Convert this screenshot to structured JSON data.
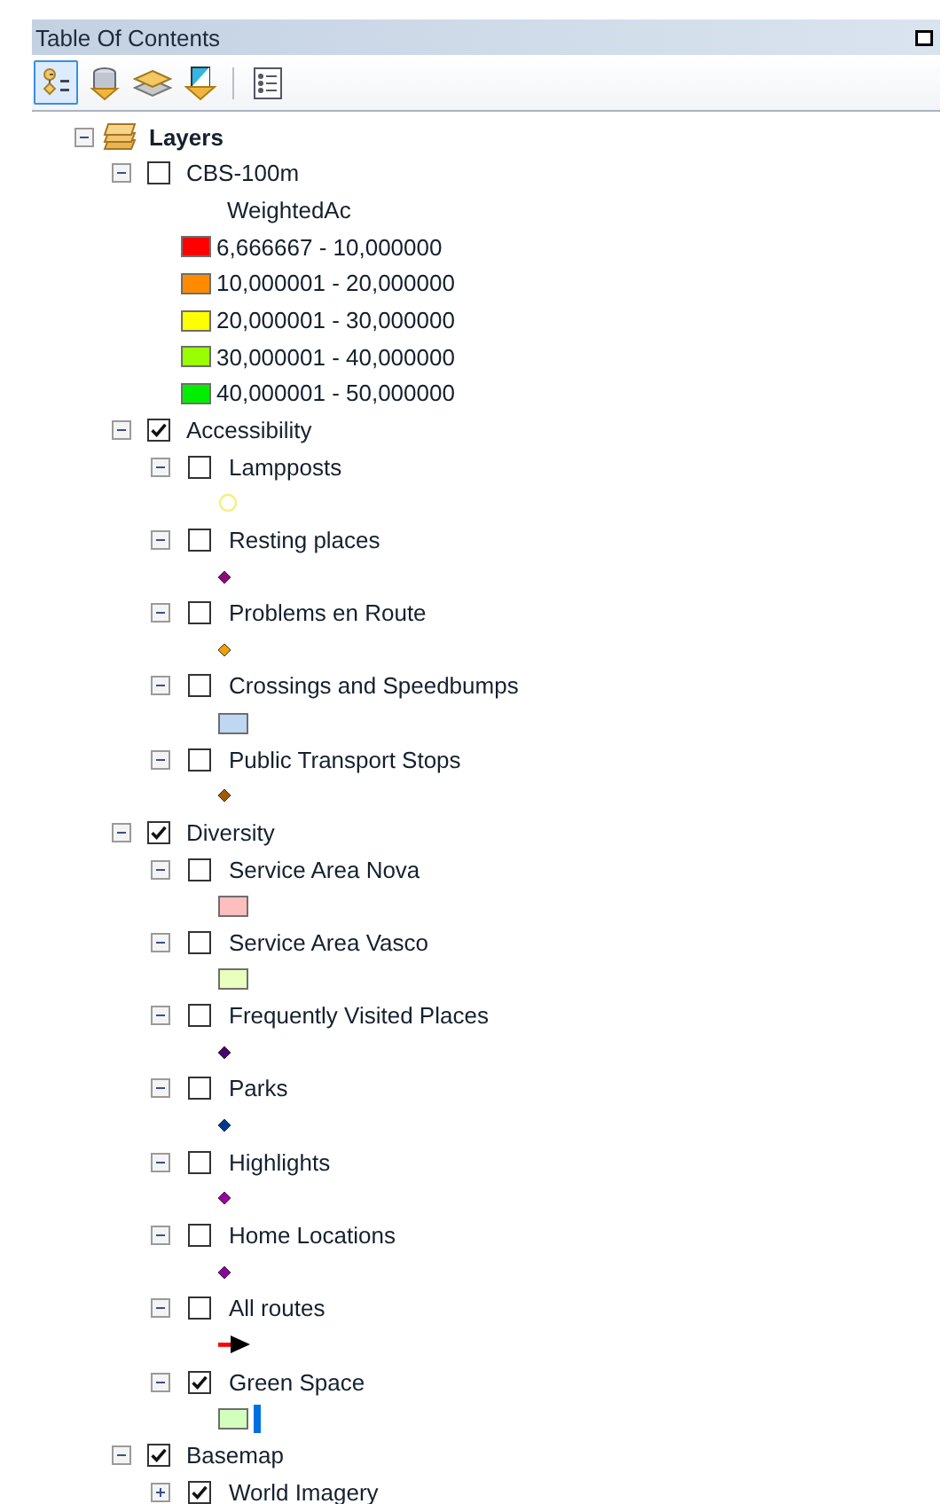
{
  "panel": {
    "title": "Table Of Contents"
  },
  "toolbar": [
    {
      "kind": "drawing-order",
      "selected": true
    },
    {
      "kind": "source",
      "selected": false
    },
    {
      "kind": "visibility",
      "selected": false
    },
    {
      "kind": "selection",
      "selected": false
    },
    {
      "kind": "options",
      "selected": false
    }
  ],
  "tree": {
    "name": "Layers",
    "expanded": true,
    "groups": [
      {
        "name": "CBS-100m",
        "checked": false,
        "expanded": true,
        "legend": {
          "heading": "WeightedAc",
          "classes": [
            {
              "label": "6,666667 - 10,000000",
              "color": "#ff0000"
            },
            {
              "label": "10,000001 - 20,000000",
              "color": "#ff8c00"
            },
            {
              "label": "20,000001 - 30,000000",
              "color": "#ffff00"
            },
            {
              "label": "30,000001 - 40,000000",
              "color": "#99ff00"
            },
            {
              "label": "40,000001 - 50,000000",
              "color": "#00ee00"
            }
          ]
        }
      },
      {
        "name": "Accessibility",
        "checked": true,
        "expanded": true,
        "layers": [
          {
            "name": "Lampposts",
            "checked": false,
            "expanded": true,
            "symbols": [
              {
                "kind": "circle",
                "color": "#f4f07a"
              }
            ]
          },
          {
            "name": "Resting places",
            "checked": false,
            "expanded": true,
            "symbols": [
              {
                "kind": "diamond",
                "color": "#8b0a80"
              }
            ]
          },
          {
            "name": "Problems en Route",
            "checked": false,
            "expanded": true,
            "symbols": [
              {
                "kind": "diamond",
                "color": "#f0a000"
              }
            ]
          },
          {
            "name": "Crossings and Speedbumps",
            "checked": false,
            "expanded": true,
            "symbols": [
              {
                "kind": "rect",
                "color": "#bed7f2"
              }
            ]
          },
          {
            "name": "Public Transport Stops",
            "checked": false,
            "expanded": true,
            "symbols": [
              {
                "kind": "diamond",
                "color": "#a05a00"
              }
            ]
          }
        ]
      },
      {
        "name": "Diversity",
        "checked": true,
        "expanded": true,
        "layers": [
          {
            "name": "Service Area Nova",
            "checked": false,
            "expanded": true,
            "symbols": [
              {
                "kind": "rect",
                "color": "#ffbebe"
              }
            ]
          },
          {
            "name": "Service Area Vasco",
            "checked": false,
            "expanded": true,
            "symbols": [
              {
                "kind": "rect",
                "color": "#e9ffbe"
              }
            ]
          },
          {
            "name": "Frequently Visited Places",
            "checked": false,
            "expanded": true,
            "symbols": [
              {
                "kind": "diamond",
                "color": "#4c0073"
              }
            ]
          },
          {
            "name": "Parks",
            "checked": false,
            "expanded": true,
            "symbols": [
              {
                "kind": "diamond",
                "color": "#00398c"
              }
            ]
          },
          {
            "name": "Highlights",
            "checked": false,
            "expanded": true,
            "symbols": [
              {
                "kind": "diamond",
                "color": "#9c00a0"
              }
            ]
          },
          {
            "name": "Home Locations",
            "checked": false,
            "expanded": true,
            "symbols": [
              {
                "kind": "diamond",
                "color": "#8c00a0"
              }
            ]
          },
          {
            "name": "All routes",
            "checked": false,
            "expanded": true,
            "symbols": [
              {
                "kind": "arrow",
                "color": "#ff0000"
              }
            ]
          },
          {
            "name": "Green Space",
            "checked": true,
            "expanded": true,
            "symbols": [
              {
                "kind": "rect",
                "color": "#d3ffbe"
              },
              {
                "kind": "bar",
                "color": "#0070e0"
              }
            ]
          }
        ]
      },
      {
        "name": "Basemap",
        "checked": true,
        "expanded": true,
        "layers": [
          {
            "name": "World Imagery",
            "checked": true,
            "expanded": false
          }
        ]
      }
    ]
  }
}
